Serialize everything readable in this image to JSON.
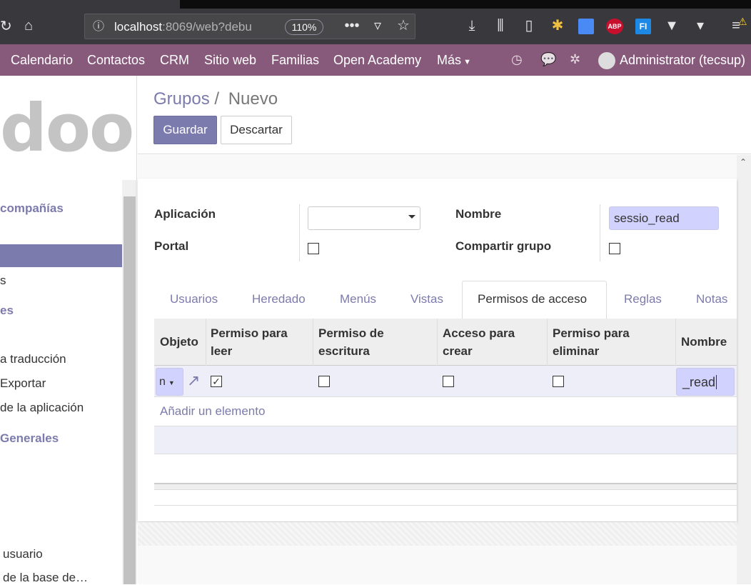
{
  "browser": {
    "url_main": "localhost",
    "url_rest": ":8069/web?debu",
    "zoom": "110%",
    "more_menu": "•••"
  },
  "nav": {
    "items": [
      "Calendario",
      "Contactos",
      "CRM",
      "Sitio web",
      "Familias",
      "Open Academy",
      "Más"
    ],
    "user": "Administrator (tecsup)"
  },
  "sidebar": {
    "logo": "doo",
    "items": [
      {
        "label": "compañías",
        "head": true
      },
      {
        "label": "s",
        "head": false
      },
      {
        "label": "es",
        "head": true
      },
      {
        "label": "a traducción",
        "head": false
      },
      {
        "label": "Exportar",
        "head": false
      },
      {
        "label": "de la aplicación",
        "head": false
      },
      {
        "label": "Generales",
        "head": true
      },
      {
        "label": "usuario",
        "head": false
      },
      {
        "label": "de la base de…",
        "head": false
      }
    ]
  },
  "breadcrumb": {
    "parent": "Grupos",
    "separator": "/",
    "current": "Nuevo"
  },
  "buttons": {
    "save": "Guardar",
    "discard": "Descartar"
  },
  "form": {
    "application_label": "Aplicación",
    "application_value": "",
    "name_label": "Nombre",
    "name_value": "sessio_read",
    "portal_label": "Portal",
    "share_label": "Compartir grupo"
  },
  "tabs": [
    "Usuarios",
    "Heredado",
    "Menús",
    "Vistas",
    "Permisos de acceso",
    "Reglas",
    "Notas"
  ],
  "active_tab": "Permisos de acceso",
  "table": {
    "headers": {
      "object": "Objeto",
      "read_1": "Permiso para",
      "read_2": "leer",
      "write_1": "Permiso de",
      "write_2": "escritura",
      "create_1": "Acceso para",
      "create_2": "crear",
      "unlink_1": "Permiso para",
      "unlink_2": "eliminar",
      "name": "Nombre"
    },
    "edit_row": {
      "object_value": "n",
      "perm_read": true,
      "perm_write": false,
      "perm_create": false,
      "perm_unlink": false,
      "name_value": "_read"
    },
    "add_line": "Añadir un elemento"
  },
  "colors": {
    "nav_bg": "#875a7b",
    "accent": "#7c7bad",
    "input_highlight": "#d2d2ff"
  }
}
